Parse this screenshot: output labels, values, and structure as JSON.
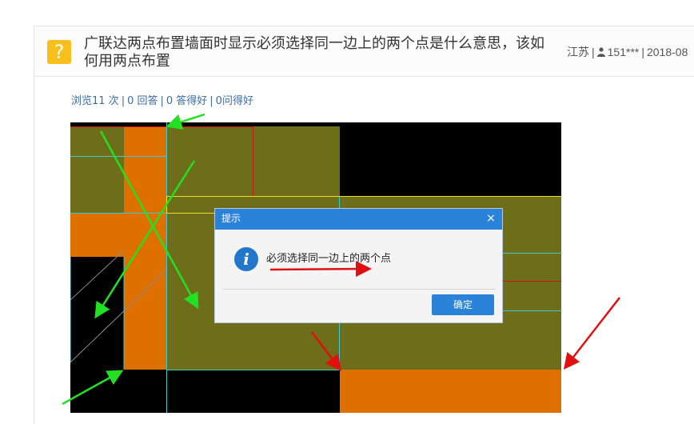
{
  "question": {
    "icon": "question-icon",
    "icon_glyph": "?",
    "title": "广联达两点布置墙面时显示必须选择同一边上的两个点是什么意思，该如何用两点布置",
    "location": "江苏",
    "user": "151***",
    "date": "2018-08"
  },
  "stats": {
    "views": "浏览11 次",
    "answers": "0 回答",
    "good_answers": "0 答得好",
    "good_questions": "0问得好"
  },
  "dialog": {
    "title": "提示",
    "close_glyph": "×",
    "info_icon_glyph": "i",
    "message": "必须选择同一边上的两个点",
    "ok_label": "确定"
  },
  "colors": {
    "accent_blue": "#2b82d9",
    "question_icon_yellow": "#f8bf1c",
    "cad_olive": "#6e6e1a",
    "cad_orange": "#de7000",
    "cad_cyan": "#3ec8d0",
    "annotation_green": "#22e022",
    "annotation_red": "#e01010"
  }
}
